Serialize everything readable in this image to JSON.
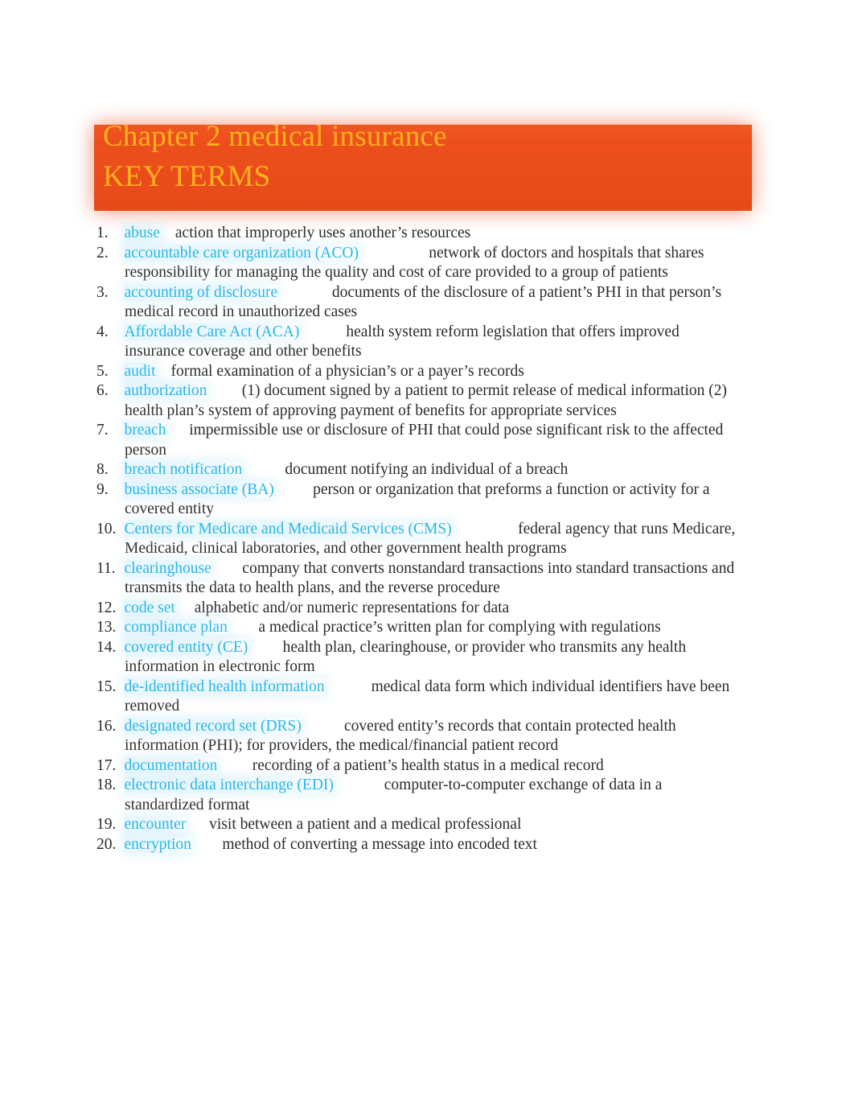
{
  "document": {
    "title_line_1": "Chapter 2 medical insurance",
    "title_line_2": "KEY TERMS",
    "banner_color": "#ea4b1d",
    "title_color": "#ffb01e",
    "term_color": "#29b6e8",
    "body_color": "#2b2b2b"
  },
  "key_terms": [
    {
      "number": "1.",
      "term": "abuse",
      "gap": "    ",
      "definition": "action that improperly uses another’s resources"
    },
    {
      "number": "2.",
      "term": "accountable care organization (ACO)",
      "gap": "                  ",
      "definition": "network of doctors and hospitals that shares responsibility for managing the quality and cost of care provided to a group of patients"
    },
    {
      "number": "3.",
      "term": "accounting of disclosure",
      "gap": "              ",
      "definition": "documents of the disclosure of a patient’s PHI in that person’s medical record in unauthorized cases"
    },
    {
      "number": "4.",
      "term": "Affordable Care Act (ACA)",
      "gap": "            ",
      "definition": "health system reform legislation that offers improved insurance coverage and other benefits"
    },
    {
      "number": "5.",
      "term": "audit",
      "gap": "    ",
      "definition": "formal examination of a physician’s or a payer’s records"
    },
    {
      "number": "6.",
      "term": "authorization",
      "gap": "         ",
      "definition": "(1) document signed by a patient to permit release of medical information (2) health plan’s system of approving payment of benefits for appropriate services"
    },
    {
      "number": "7.",
      "term": "breach",
      "gap": "      ",
      "definition": "impermissible use or disclosure of PHI that could pose significant risk to the affected person"
    },
    {
      "number": "8.",
      "term": "breach notification",
      "gap": "           ",
      "definition": "document notifying an individual of a breach"
    },
    {
      "number": "9.",
      "term": "business associate (BA)",
      "gap": "          ",
      "definition": "person or organization that preforms a function or activity for a covered entity"
    },
    {
      "number": "10.",
      "term": "Centers for Medicare and Medicaid Services (CMS)",
      "gap": "                 ",
      "definition": "federal agency that runs Medicare, Medicaid, clinical laboratories, and other government health programs"
    },
    {
      "number": "11.",
      "term": "clearinghouse",
      "gap": "        ",
      "definition": "company that converts nonstandard transactions into standard transactions and transmits the data to health plans, and the reverse procedure"
    },
    {
      "number": "12.",
      "term": "code set",
      "gap": "     ",
      "definition": "alphabetic and/or numeric representations for data"
    },
    {
      "number": "13.",
      "term": "compliance plan",
      "gap": "        ",
      "definition": "a medical practice’s written plan for complying with regulations"
    },
    {
      "number": "14.",
      "term": "covered entity (CE)",
      "gap": "         ",
      "definition": "health plan, clearinghouse, or provider who transmits any health information in electronic form"
    },
    {
      "number": "15.",
      "term": "de-identified health information",
      "gap": "            ",
      "definition": "medical data form which individual identifiers have been removed"
    },
    {
      "number": "16.",
      "term": "designated record set (DRS)",
      "gap": "           ",
      "definition": "covered entity’s records that contain protected health information (PHI); for providers, the medical/financial patient record"
    },
    {
      "number": "17.",
      "term": "documentation",
      "gap": "         ",
      "definition": "recording of a patient’s health status in a medical record"
    },
    {
      "number": "18.",
      "term": "electronic data interchange (EDI)",
      "gap": "             ",
      "definition": "computer-to-computer exchange of data in a standardized format"
    },
    {
      "number": "19.",
      "term": "encounter",
      "gap": "      ",
      "definition": "visit between a patient and a medical professional"
    },
    {
      "number": "20.",
      "term": "encryption",
      "gap": "        ",
      "definition": "method of converting a message into encoded text"
    }
  ]
}
